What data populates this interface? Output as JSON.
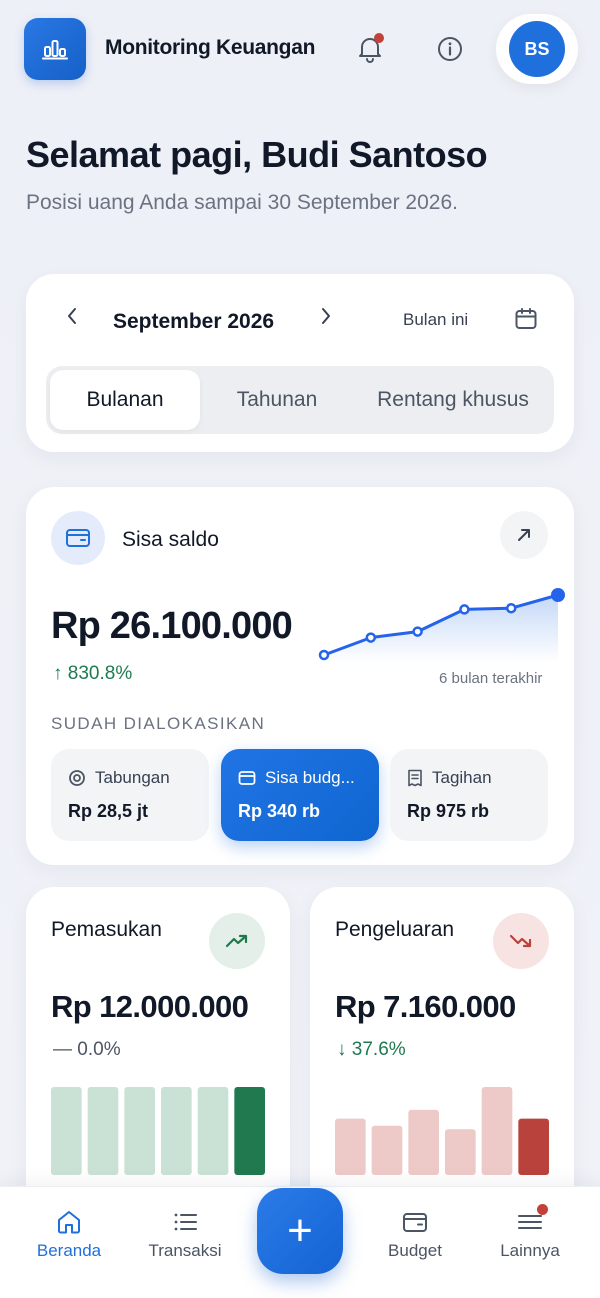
{
  "header": {
    "app_title": "Monitoring Keuangan",
    "avatar_initials": "BS",
    "notification_dot": true
  },
  "greeting": {
    "title": "Selamat pagi, Budi Santoso",
    "subtitle": "Posisi uang Anda sampai 30 September 2026."
  },
  "period": {
    "month_label": "September 2026",
    "current_label": "Bulan ini",
    "tabs": [
      "Bulanan",
      "Tahunan",
      "Rentang khusus"
    ],
    "active_tab": "Bulanan"
  },
  "balance": {
    "label": "Sisa saldo",
    "amount": "Rp 26.100.000",
    "change": "↑ 830.8%",
    "chart_caption": "6 bulan terakhir",
    "allocated_label": "SUDAH DIALOKASIKAN",
    "allocations": [
      {
        "label": "Tabungan",
        "value": "Rp 28,5 jt",
        "icon": "target-icon"
      },
      {
        "label": "Sisa budg...",
        "value": "Rp 340 rb",
        "icon": "wallet-icon"
      },
      {
        "label": "Tagihan",
        "value": "Rp 975 rb",
        "icon": "receipt-icon"
      }
    ],
    "sparkline_relative": [
      0.0,
      0.29,
      0.39,
      0.76,
      0.78,
      1.0
    ]
  },
  "income": {
    "title": "Pemasukan",
    "amount": "Rp 12.000.000",
    "change": "— 0.0%",
    "bars_relative": [
      1,
      1,
      1,
      1,
      1,
      1
    ]
  },
  "expense": {
    "title": "Pengeluaran",
    "amount": "Rp 7.160.000",
    "change": "↓ 37.6%",
    "bars_relative": [
      0.64,
      0.56,
      0.74,
      0.52,
      1.0,
      0.64
    ]
  },
  "nav": {
    "items": [
      "Beranda",
      "Transaksi",
      "Budget",
      "Lainnya"
    ],
    "active": "Beranda",
    "fab_label": "+"
  },
  "colors": {
    "primary": "#1f6fdc",
    "income_green": "#1e7a4e",
    "expense_red": "#b9433c",
    "notification": "#c2413a"
  }
}
